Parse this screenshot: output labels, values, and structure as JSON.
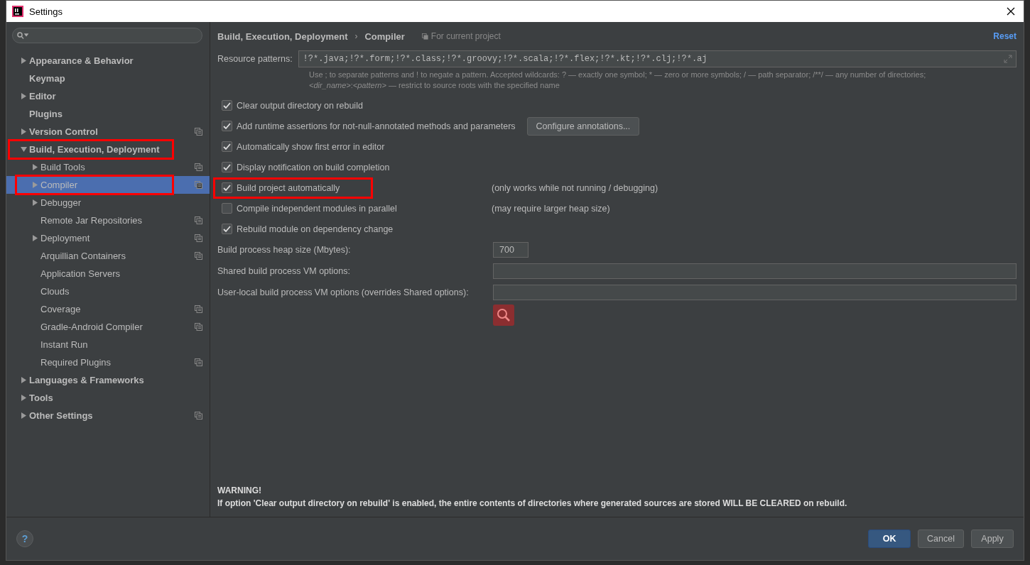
{
  "window": {
    "title": "Settings"
  },
  "sidebar": {
    "items": [
      {
        "label": "Appearance & Behavior",
        "expanded": false,
        "selected": false,
        "highlighted": false,
        "project_level": false
      },
      {
        "label": "Keymap",
        "selected": false,
        "highlighted": false,
        "project_level": false
      },
      {
        "label": "Editor",
        "expanded": false,
        "selected": false,
        "highlighted": false,
        "project_level": false
      },
      {
        "label": "Plugins",
        "selected": false,
        "highlighted": false,
        "project_level": false
      },
      {
        "label": "Version Control",
        "expanded": false,
        "selected": false,
        "highlighted": false,
        "project_level": true
      },
      {
        "label": "Build, Execution, Deployment",
        "expanded": true,
        "selected": false,
        "highlighted": true,
        "project_level": false,
        "children": [
          {
            "label": "Build Tools",
            "expanded": false,
            "selected": false,
            "highlighted": false,
            "project_level": true
          },
          {
            "label": "Compiler",
            "expanded": false,
            "selected": true,
            "highlighted": true,
            "project_level": true
          },
          {
            "label": "Debugger",
            "expanded": false,
            "selected": false,
            "highlighted": false,
            "project_level": false
          },
          {
            "label": "Remote Jar Repositories",
            "selected": false,
            "highlighted": false,
            "project_level": true
          },
          {
            "label": "Deployment",
            "expanded": false,
            "selected": false,
            "highlighted": false,
            "project_level": true
          },
          {
            "label": "Arquillian Containers",
            "selected": false,
            "highlighted": false,
            "project_level": true
          },
          {
            "label": "Application Servers",
            "selected": false,
            "highlighted": false,
            "project_level": false
          },
          {
            "label": "Clouds",
            "selected": false,
            "highlighted": false,
            "project_level": false
          },
          {
            "label": "Coverage",
            "selected": false,
            "highlighted": false,
            "project_level": true
          },
          {
            "label": "Gradle-Android Compiler",
            "selected": false,
            "highlighted": false,
            "project_level": true
          },
          {
            "label": "Instant Run",
            "selected": false,
            "highlighted": false,
            "project_level": false
          },
          {
            "label": "Required Plugins",
            "selected": false,
            "highlighted": false,
            "project_level": true
          }
        ]
      },
      {
        "label": "Languages & Frameworks",
        "expanded": false,
        "selected": false,
        "highlighted": false,
        "project_level": false
      },
      {
        "label": "Tools",
        "expanded": false,
        "selected": false,
        "highlighted": false,
        "project_level": false
      },
      {
        "label": "Other Settings",
        "expanded": false,
        "selected": false,
        "highlighted": false,
        "project_level": true
      }
    ]
  },
  "breadcrumb": [
    "Build, Execution, Deployment",
    "›",
    "Compiler"
  ],
  "scope": "For current project",
  "reset": "Reset",
  "resource_patterns": {
    "label": "Resource patterns:",
    "value": "!?*.java;!?*.form;!?*.class;!?*.groovy;!?*.scala;!?*.flex;!?*.kt;!?*.clj;!?*.aj",
    "hint": [
      "Use ; to separate patterns and ! to negate a pattern. Accepted wildcards: ? — exactly one symbol; * — zero or more symbols; / — path separator; /**/ — any number of directories;",
      "*<dir_name>*:*<pattern>* — restrict to source roots with the specified name"
    ]
  },
  "options": [
    {
      "label": "Clear output directory on rebuild",
      "checked": true,
      "highlighted": false
    },
    {
      "label": "Add runtime assertions for not-null-annotated methods and parameters",
      "checked": true,
      "highlighted": false,
      "button": "Configure annotations..."
    },
    {
      "label": "Automatically show first error in editor",
      "checked": true,
      "highlighted": false
    },
    {
      "label": "Display notification on build completion",
      "checked": true,
      "highlighted": false
    },
    {
      "label": "Build project automatically",
      "checked": true,
      "highlighted": true,
      "note": "(only works while not running / debugging)"
    },
    {
      "label": "Compile independent modules in parallel",
      "checked": false,
      "highlighted": false,
      "note": "(may require larger heap size)"
    },
    {
      "label": "Rebuild module on dependency change",
      "checked": true,
      "highlighted": false
    }
  ],
  "fields": [
    {
      "label": "Build process heap size (Mbytes):",
      "value": "700",
      "kind": "short"
    },
    {
      "label": "Shared build process VM options:",
      "kind": "wide"
    },
    {
      "label": "User-local build process VM options (overrides Shared options):",
      "kind": "wide"
    }
  ],
  "help": "?",
  "warning": {
    "title": "WARNING!",
    "text": "If option 'Clear output directory on rebuild' is enabled, the entire contents of directories where generated sources are stored WILL BE CLEARED on rebuild."
  },
  "buttons": [
    {
      "label": "OK",
      "kind": "primary"
    },
    {
      "label": "Cancel",
      "kind": "normal"
    },
    {
      "label": "Apply",
      "kind": "normal"
    }
  ]
}
